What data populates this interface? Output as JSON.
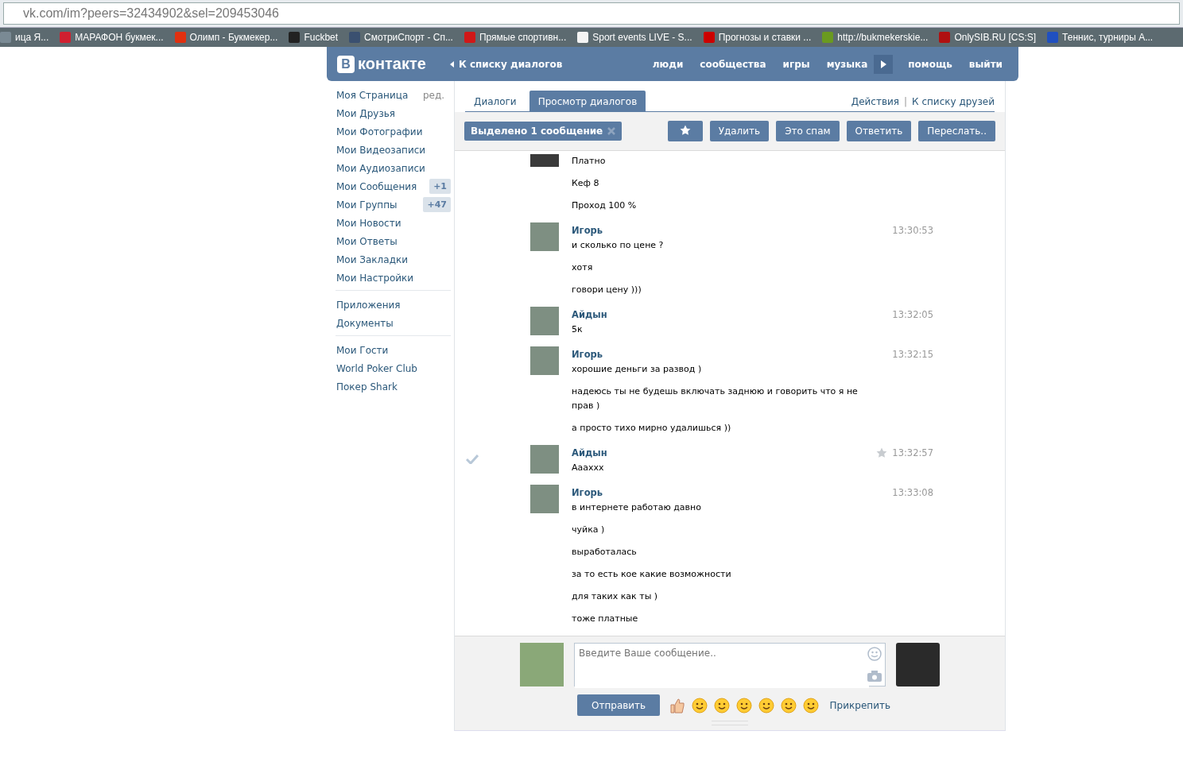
{
  "browser": {
    "address": "vk.com/im?peers=32434902&sel=209453046",
    "bookmarks": [
      {
        "label": "ица Я...",
        "color": "#7a8a94"
      },
      {
        "label": "МАРАФОН букмек...",
        "color": "#d02030"
      },
      {
        "label": "Олимп - Букмекер...",
        "color": "#e03010"
      },
      {
        "label": "Fuckbet",
        "color": "#222222"
      },
      {
        "label": "СмотриСпорт - Сп...",
        "color": "#3a5070"
      },
      {
        "label": "Прямые спортивн...",
        "color": "#d01818"
      },
      {
        "label": "Sport events LIVE - S...",
        "color": "#f4f4f4"
      },
      {
        "label": "Прогнозы и ставки ...",
        "color": "#cc0000"
      },
      {
        "label": "http://bukmekerskie...",
        "color": "#6a9a20"
      },
      {
        "label": "OnlySIB.RU [CS:S]",
        "color": "#b01010"
      },
      {
        "label": "Теннис, турниры А...",
        "color": "#2050c0"
      }
    ]
  },
  "header": {
    "logo": "контакте",
    "logo_letter": "В",
    "back": "К списку диалогов",
    "nav": [
      "люди",
      "сообщества",
      "игры",
      "музыка"
    ],
    "nav_right": [
      "помощь",
      "выйти"
    ]
  },
  "sidebar": {
    "edit": "ред.",
    "groups": [
      [
        {
          "label": "Моя Страница"
        },
        {
          "label": "Мои Друзья"
        },
        {
          "label": "Мои Фотографии"
        },
        {
          "label": "Мои Видеозаписи"
        },
        {
          "label": "Мои Аудиозаписи"
        },
        {
          "label": "Мои Сообщения",
          "badge": "+1"
        },
        {
          "label": "Мои Группы",
          "badge": "+47"
        },
        {
          "label": "Мои Новости"
        },
        {
          "label": "Мои Ответы"
        },
        {
          "label": "Мои Закладки"
        },
        {
          "label": "Мои Настройки"
        }
      ],
      [
        {
          "label": "Приложения"
        },
        {
          "label": "Документы"
        }
      ],
      [
        {
          "label": "Мои Гости"
        },
        {
          "label": "World Poker Club"
        },
        {
          "label": "Покер Shark"
        }
      ]
    ]
  },
  "tabs": [
    {
      "label": "Диалоги",
      "selected": false
    },
    {
      "label": "Просмотр диалогов",
      "selected": true
    }
  ],
  "tab_links": [
    "Действия",
    "К списку друзей"
  ],
  "tab_link_separator": "|",
  "toolbar": {
    "selection": "Выделено 1 сообщение",
    "buttons": [
      "Удалить",
      "Это спам",
      "Ответить",
      "Переслать.."
    ]
  },
  "messages": [
    {
      "selected": false,
      "lines": [
        "Платно",
        "Кеф 8",
        "Проход 100 %"
      ]
    },
    {
      "author": "Игорь",
      "time": "13:30:53",
      "selected": false,
      "lines": [
        "и сколько по цене ?",
        "хотя",
        "говори цену )))"
      ]
    },
    {
      "author": "Айдын",
      "time": "13:32:05",
      "selected": false,
      "lines": [
        "5к"
      ]
    },
    {
      "author": "Игорь",
      "time": "13:32:15",
      "selected": false,
      "lines": [
        "хорошие деньги за развод )",
        "надеюсь ты не будешь включать заднюю и говорить что я не прав )",
        "а просто тихо мирно удалишься ))"
      ]
    },
    {
      "author": "Айдын",
      "time": "13:32:57",
      "selected": true,
      "lines": [
        "Ааахxx"
      ]
    },
    {
      "author": "Игорь",
      "time": "13:33:08",
      "selected": false,
      "lines": [
        "в интернете работаю давно",
        "чуйка )",
        "выработалась",
        "за то есть кое какие возможности",
        "для таких как ты )",
        "тоже платные"
      ]
    }
  ],
  "composer": {
    "placeholder": "Введите Ваше сообщение..",
    "send": "Отправить",
    "attach": "Прикрепить"
  }
}
